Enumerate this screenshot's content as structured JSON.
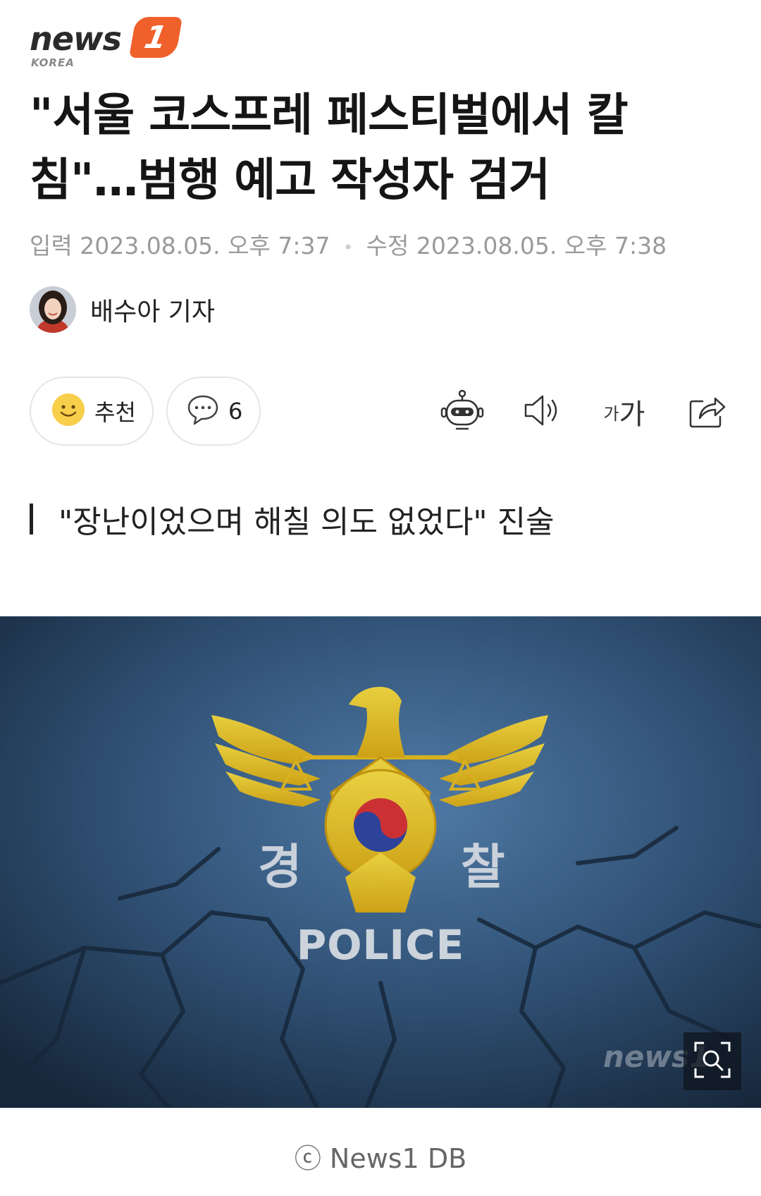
{
  "logo": {
    "wordmark": "news",
    "badge": "1",
    "sub": "KOREA"
  },
  "article": {
    "headline_line1": "\"서울 코스프레 페스티벌에서 칼",
    "headline_line2": "침\"…범행 예고 작성자 검거",
    "published_label": "입력",
    "published": "2023.08.05. 오후 7:37",
    "modified_label": "수정",
    "modified": "2023.08.05. 오후 7:38",
    "reporter": "배수아 기자",
    "subtitle": "\"장난이었으며 해칠 의도 없었다\" 진술"
  },
  "actions": {
    "like_label": "추천",
    "comment_count": "6",
    "font_size_small": "가",
    "font_size_large": "가"
  },
  "photo": {
    "left_char": "경",
    "right_char": "찰",
    "police_text": "POLICE",
    "watermark": "news1"
  },
  "caption": "ⓒ News1 DB",
  "colors": {
    "brand": "#f0602a",
    "emblem_gold": "#f2c91a",
    "photo_bg": "#3a5f86"
  }
}
